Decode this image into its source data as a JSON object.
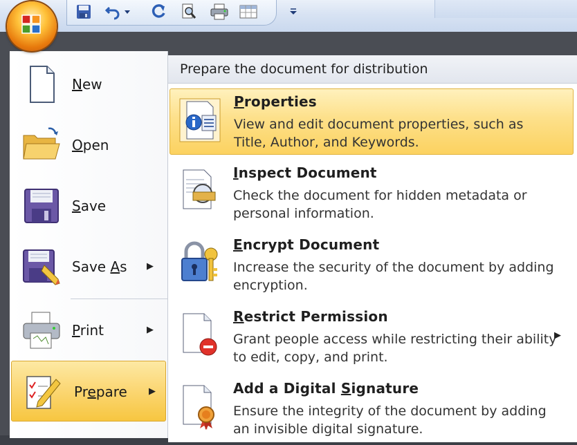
{
  "colors": {
    "office_orange": "#f29a1b",
    "highlight_gold": "#fcd260",
    "toolbar_blue": "#d8e3f3",
    "menu_frame": "#4a4d54"
  },
  "toolbar": {
    "items": [
      {
        "name": "save-icon"
      },
      {
        "name": "undo-icon"
      },
      {
        "name": "undo-dropdown-icon"
      },
      {
        "name": "redo-icon"
      },
      {
        "name": "print-preview-icon"
      },
      {
        "name": "quick-print-icon"
      },
      {
        "name": "table-icon"
      },
      {
        "name": "customize-toolbar-icon"
      }
    ]
  },
  "left_menu": {
    "items": [
      {
        "label_pre": "",
        "label_u": "N",
        "label_post": "ew",
        "icon": "new-document-icon",
        "arrow": ""
      },
      {
        "label_pre": "",
        "label_u": "O",
        "label_post": "pen",
        "icon": "open-folder-icon",
        "arrow": ""
      },
      {
        "label_pre": "",
        "label_u": "S",
        "label_post": "ave",
        "icon": "save-disk-icon",
        "arrow": ""
      },
      {
        "label_pre": "Save ",
        "label_u": "A",
        "label_post": "s",
        "icon": "save-as-icon",
        "arrow": "▶"
      },
      {
        "label_pre": "",
        "label_u": "P",
        "label_post": "rint",
        "icon": "printer-icon",
        "arrow": "▶"
      },
      {
        "label_pre": "Pr",
        "label_u": "e",
        "label_post": "pare",
        "icon": "prepare-icon",
        "arrow": "▶"
      }
    ]
  },
  "right_panel": {
    "header": "Prepare the document for distribution",
    "items": [
      {
        "title_pre": "",
        "title_u": "P",
        "title_post": "roperties",
        "desc": "View and edit document properties, such as Title, Author, and Keywords.",
        "icon": "properties-icon",
        "arrow": ""
      },
      {
        "title_pre": "",
        "title_u": "I",
        "title_post": "nspect Document",
        "desc": "Check the document for hidden metadata or personal information.",
        "icon": "inspect-document-icon",
        "arrow": ""
      },
      {
        "title_pre": "",
        "title_u": "E",
        "title_post": "ncrypt Document",
        "desc": "Increase the security of the document by adding encryption.",
        "icon": "encrypt-lock-icon",
        "arrow": ""
      },
      {
        "title_pre": "",
        "title_u": "R",
        "title_post": "estrict Permission",
        "desc": "Grant people access while restricting their ability to edit, copy, and print.",
        "icon": "restrict-permission-icon",
        "arrow": "▶"
      },
      {
        "title_pre": "Add a Digital ",
        "title_u": "S",
        "title_post": "ignature",
        "desc": "Ensure the integrity of the document by adding an invisible digital signature.",
        "icon": "digital-signature-icon",
        "arrow": ""
      }
    ]
  }
}
